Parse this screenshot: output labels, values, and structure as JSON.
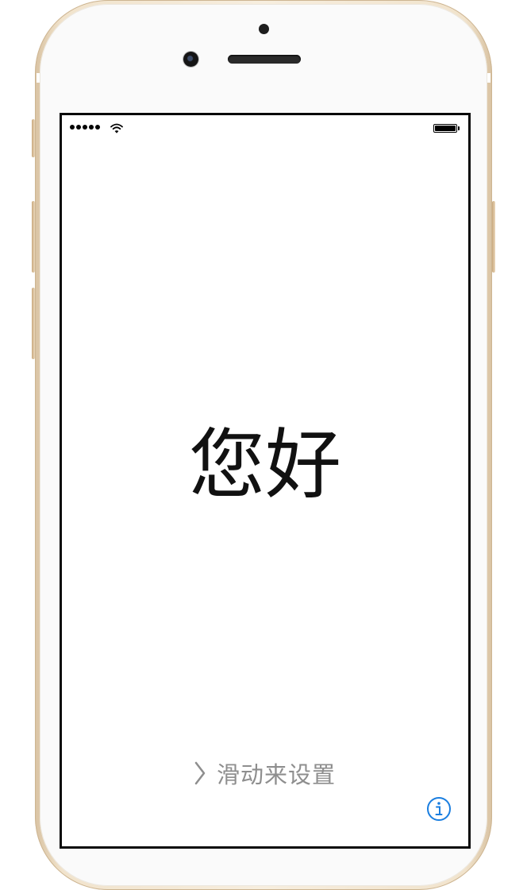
{
  "device": {
    "frame_color": "#f2e4cd",
    "face_color": "#fafafa"
  },
  "status_bar": {
    "signal_icon": "cellular-signal-dots-icon",
    "wifi_icon": "wifi-icon",
    "battery_icon": "battery-full-icon",
    "battery_level": 1.0
  },
  "setup_screen": {
    "greeting": "您好",
    "slide_icon": "chevron-right-icon",
    "slide_label": "滑动来设置",
    "info_icon": "info-circle-icon",
    "info_color": "#1a7ee0"
  }
}
